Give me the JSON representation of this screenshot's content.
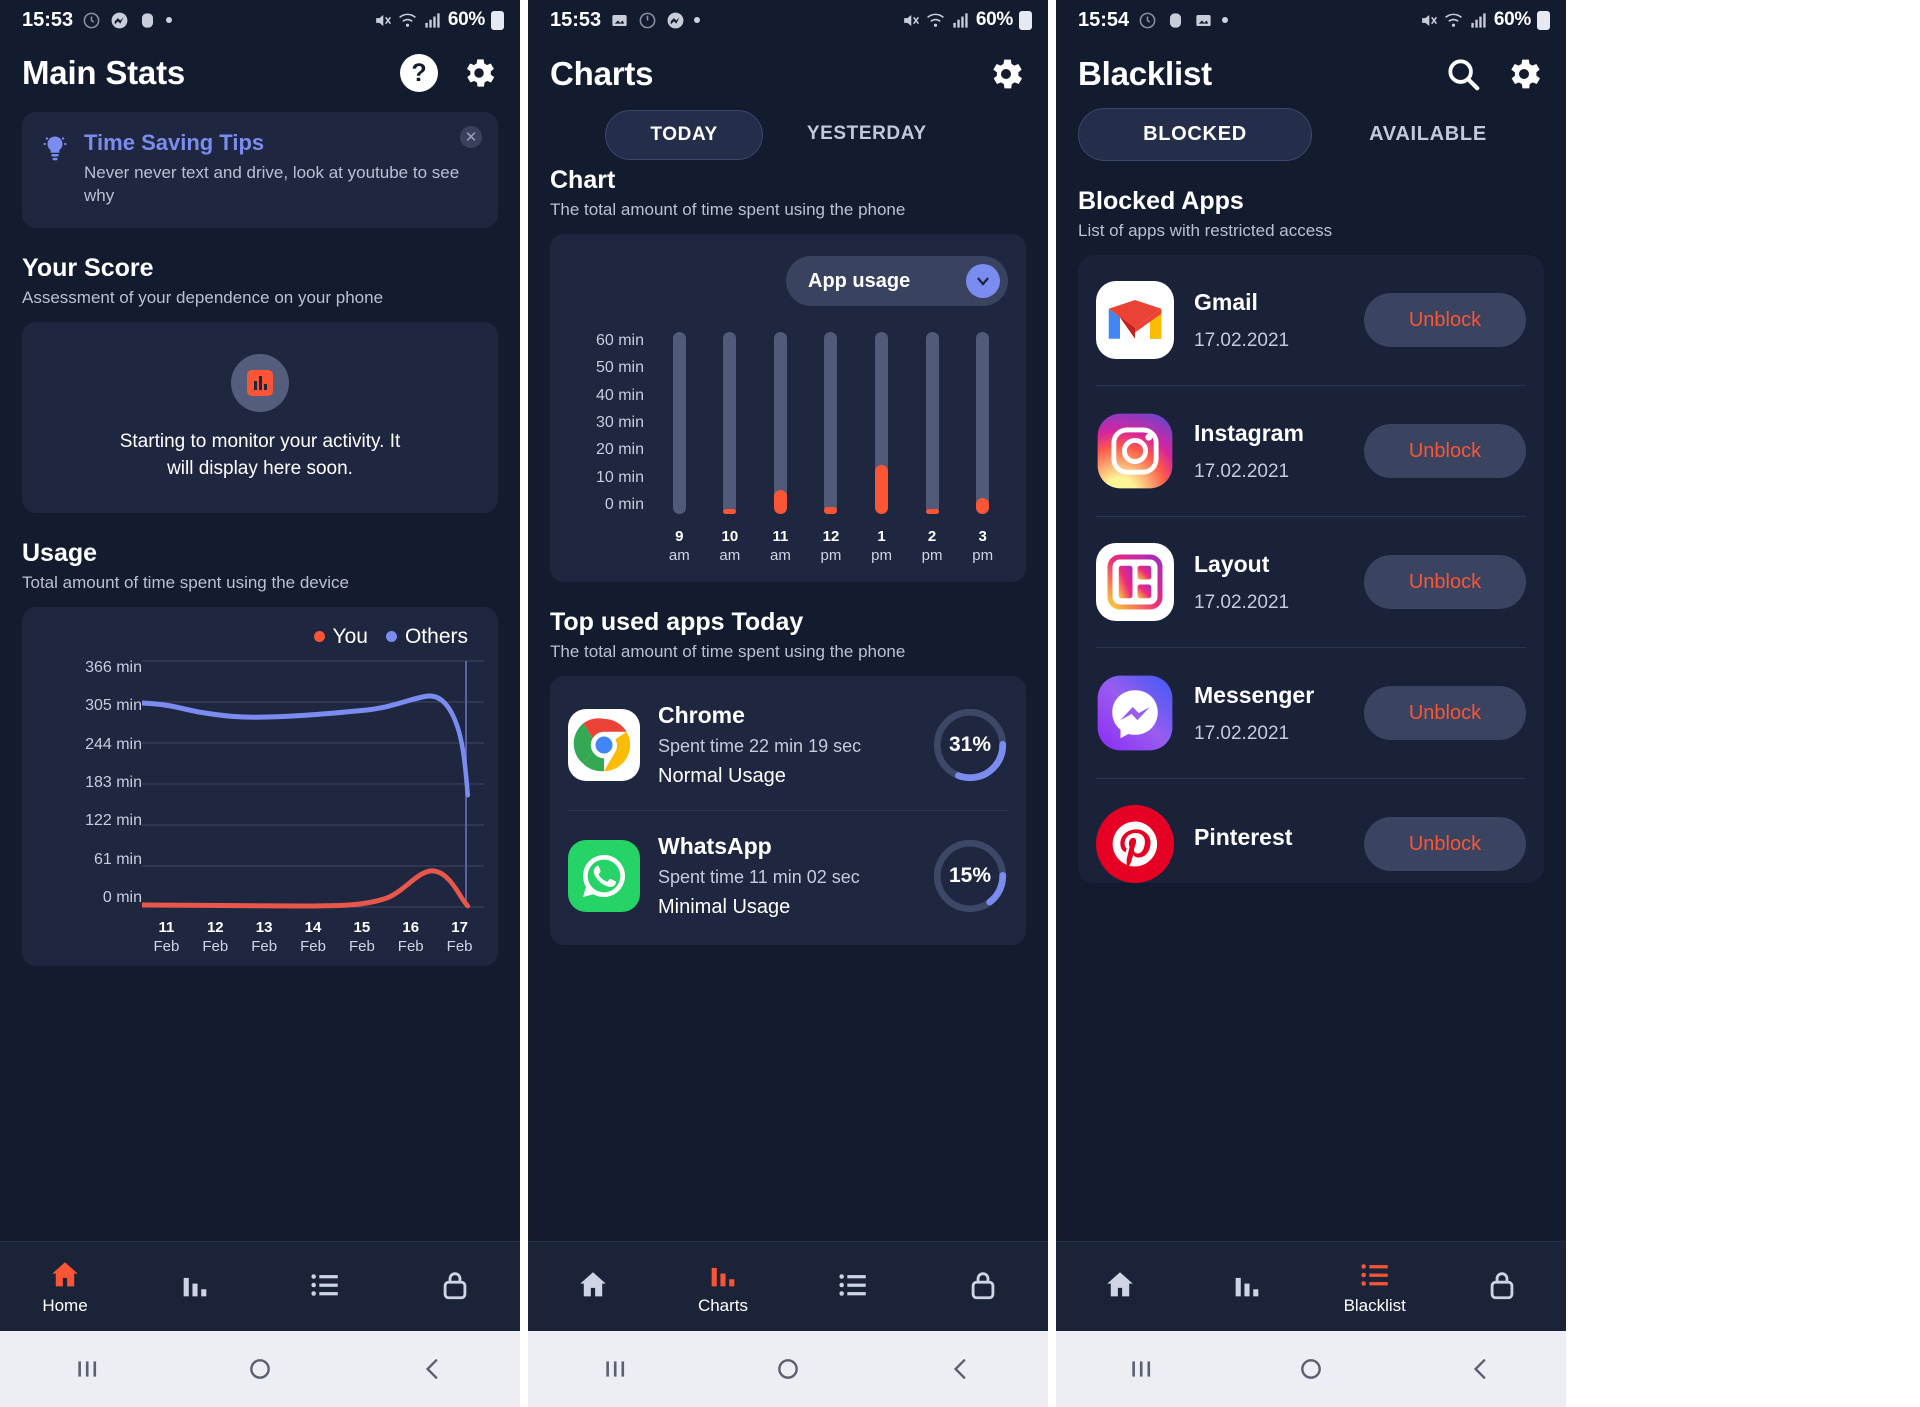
{
  "screens": [
    {
      "id": "main-stats",
      "statusbar": {
        "time": "15:53",
        "battery": "60%"
      },
      "title": "Main Stats",
      "tip": {
        "title": "Time Saving Tips",
        "text": "Never never text and drive, look at youtube to see why"
      },
      "score": {
        "heading": "Your Score",
        "sub": "Assessment of your dependence on your phone",
        "placeholder": "Starting to monitor your activity. It will display here soon."
      },
      "usage": {
        "heading": "Usage",
        "sub": "Total amount of time spent using the device",
        "legend": [
          "You",
          "Others"
        ]
      },
      "nav": [
        {
          "label": "Home",
          "icon": "home-icon",
          "active": true
        },
        {
          "label": "",
          "icon": "bars-icon",
          "active": false
        },
        {
          "label": "",
          "icon": "list-icon",
          "active": false
        },
        {
          "label": "",
          "icon": "lock-icon",
          "active": false
        }
      ]
    },
    {
      "id": "charts",
      "statusbar": {
        "time": "15:53",
        "battery": "60%"
      },
      "title": "Charts",
      "tabs": [
        {
          "label": "TODAY",
          "active": true
        },
        {
          "label": "YESTERDAY",
          "active": false
        }
      ],
      "chart": {
        "heading": "Chart",
        "sub": "The total amount of time spent using the phone",
        "dropdown": "App usage"
      },
      "topapps": {
        "heading": "Top used apps Today",
        "sub": "The total amount of time spent using the phone",
        "items": [
          {
            "name": "Chrome",
            "spent": "Spent time 22 min 19  sec",
            "usage": "Normal Usage",
            "percent": "31%",
            "percent_value": 31,
            "icon": "chrome-icon"
          },
          {
            "name": "WhatsApp",
            "spent": "Spent time 11 min 02  sec",
            "usage": "Minimal Usage",
            "percent": "15%",
            "percent_value": 15,
            "icon": "whatsapp-icon"
          }
        ]
      },
      "nav": [
        {
          "label": "",
          "icon": "home-icon",
          "active": false
        },
        {
          "label": "Charts",
          "icon": "bars-icon",
          "active": true
        },
        {
          "label": "",
          "icon": "list-icon",
          "active": false
        },
        {
          "label": "",
          "icon": "lock-icon",
          "active": false
        }
      ]
    },
    {
      "id": "blacklist",
      "statusbar": {
        "time": "15:54",
        "battery": "60%"
      },
      "title": "Blacklist",
      "tabs": [
        {
          "label": "BLOCKED",
          "active": true
        },
        {
          "label": "AVAILABLE",
          "active": false
        }
      ],
      "blocked": {
        "heading": "Blocked Apps",
        "sub": "List of apps with restricted access",
        "action_label": "Unblock",
        "items": [
          {
            "name": "Gmail",
            "date": "17.02.2021",
            "icon": "gmail-icon"
          },
          {
            "name": "Instagram",
            "date": "17.02.2021",
            "icon": "instagram-icon"
          },
          {
            "name": "Layout",
            "date": "17.02.2021",
            "icon": "layout-icon"
          },
          {
            "name": "Messenger",
            "date": "17.02.2021",
            "icon": "messenger-icon"
          },
          {
            "name": "Pinterest",
            "date": "",
            "icon": "pinterest-icon"
          }
        ]
      },
      "nav": [
        {
          "label": "",
          "icon": "home-icon",
          "active": false
        },
        {
          "label": "",
          "icon": "bars-icon",
          "active": false
        },
        {
          "label": "Blacklist",
          "icon": "list-icon",
          "active": true
        },
        {
          "label": "",
          "icon": "lock-icon",
          "active": false
        }
      ]
    }
  ],
  "colors": {
    "accent_orange": "#fb5536",
    "accent_blue": "#7b8cf0",
    "bg": "#131b2e",
    "card": "#1f2740"
  },
  "chart_data": [
    {
      "type": "line",
      "title": "Usage",
      "subtitle": "Total amount of time spent using the device",
      "xlabel": "",
      "ylabel": "min",
      "categories": [
        "11 Feb",
        "12 Feb",
        "13 Feb",
        "14 Feb",
        "15 Feb",
        "16 Feb",
        "17 Feb"
      ],
      "yticks": [
        "366 min",
        "305 min",
        "244 min",
        "183 min",
        "122 min",
        "61 min",
        "0 min"
      ],
      "ylim": [
        0,
        366
      ],
      "grid": true,
      "legend": [
        "You",
        "Others"
      ],
      "legend_position": "top-right",
      "series": [
        {
          "name": "Others",
          "color": "#7b8cf0",
          "values": [
            303,
            296,
            288,
            289,
            292,
            316,
            125
          ]
        },
        {
          "name": "You",
          "color": "#fb5536",
          "values": [
            3,
            3,
            3,
            3,
            5,
            42,
            8
          ]
        }
      ]
    },
    {
      "type": "bar",
      "title": "Chart",
      "subtitle": "The total amount of time spent using the phone",
      "selector": "App usage",
      "xlabel": "",
      "ylabel": "min",
      "categories": [
        "9 am",
        "10 am",
        "11 am",
        "12 pm",
        "1 pm",
        "2 pm",
        "3 pm"
      ],
      "yticks": [
        "60 min",
        "50 min",
        "40 min",
        "30 min",
        "20 min",
        "10 min",
        "0 min"
      ],
      "ylim": [
        0,
        60
      ],
      "grid": false,
      "values": [
        0,
        1,
        8,
        2,
        16,
        1,
        5
      ]
    },
    {
      "type": "pie",
      "title": "Top used apps Today",
      "categories": [
        "Chrome",
        "WhatsApp"
      ],
      "values": [
        31,
        15
      ],
      "unit": "%"
    }
  ]
}
